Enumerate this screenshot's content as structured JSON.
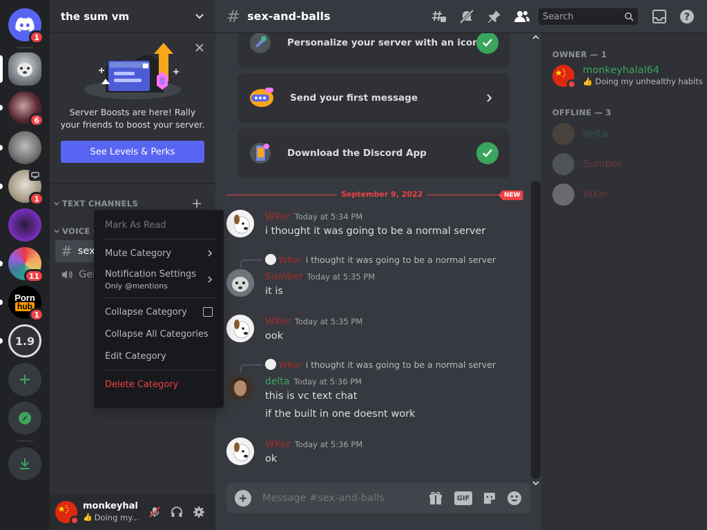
{
  "server": {
    "name": "the sum vm",
    "rail": [
      {
        "icon": "discord-home-icon",
        "badge": "1"
      },
      {
        "icon": "server-avatar",
        "badge": ""
      },
      {
        "icon": "server-avatar",
        "badge": "6"
      },
      {
        "icon": "server-avatar",
        "badge": ""
      },
      {
        "icon": "server-avatar",
        "badge": "1"
      },
      {
        "icon": "server-avatar",
        "badge": ""
      },
      {
        "icon": "server-avatar",
        "badge": "11"
      },
      {
        "icon": "server-avatar",
        "badge": "1",
        "lines": [
          "Porn",
          "hub"
        ]
      },
      {
        "icon": "server-avatar",
        "badge": "",
        "label": "1.9"
      },
      {
        "icon": "add-server-icon",
        "badge": ""
      },
      {
        "icon": "explore-icon",
        "badge": ""
      },
      {
        "icon": "download-icon",
        "badge": ""
      }
    ]
  },
  "boost": {
    "text": "Server Boosts are here! Rally your friends to boost your server.",
    "button": "See Levels & Perks"
  },
  "categories": {
    "text": "TEXT CHANNELS",
    "voice": "VOICE C"
  },
  "channels": {
    "active_text": "sex",
    "voice": "Gei"
  },
  "context_menu": {
    "mark_as_read": "Mark As Read",
    "mute_category": "Mute Category",
    "notification_settings": "Notification Settings",
    "notification_sub": "Only @mentions",
    "collapse_category": "Collapse Category",
    "collapse_all": "Collapse All Categories",
    "edit_category": "Edit Category",
    "delete_category": "Delete Category"
  },
  "user_panel": {
    "name": "monkeyhal...",
    "status": "Doing my..."
  },
  "chat": {
    "channel_name": "sex-and-balls",
    "search_placeholder": "Search",
    "cards": [
      {
        "label": "Personalize your server with an icon",
        "done": true
      },
      {
        "label": "Send your first message",
        "done": false
      },
      {
        "label": "Download the Discord App",
        "done": true
      }
    ],
    "date_divider": "September 9, 2022",
    "new_label": "NEW",
    "messages": [
      {
        "author": "WKer",
        "time": "Today at 5:34 PM",
        "text": "i thought it was going to be a normal server"
      },
      {
        "reply_author": "WKer",
        "reply_text": "i thought it was going to be a normal server",
        "author": "Sumber",
        "time": "Today at 5:35 PM",
        "text": "it is"
      },
      {
        "author": "WKer",
        "time": "Today at 5:35 PM",
        "text": "ook"
      },
      {
        "reply_author": "WKer",
        "reply_text": "i thought it was going to be a normal server",
        "author": "delta",
        "time": "Today at 5:36 PM",
        "text": "this is vc text chat",
        "text2": "if the built in one doesnt work"
      },
      {
        "author": "WKer",
        "time": "Today at 5:36 PM",
        "text": "ok"
      }
    ],
    "composer_placeholder": "Message #sex-and-balls",
    "gif_label": "GIF"
  },
  "members": {
    "owner_header": "OWNER — 1",
    "owner_name": "monkeyhalal64",
    "owner_status": "👍 Doing my unhealthy habits",
    "offline_header": "OFFLINE — 3",
    "offline": [
      "delta",
      "Sumber",
      "WKer"
    ]
  },
  "colors": {
    "blurple": "#5865f2",
    "green": "#3ba55d",
    "red": "#ed4245",
    "author_red": "#a12d2d",
    "author_green": "#3ba55d"
  }
}
